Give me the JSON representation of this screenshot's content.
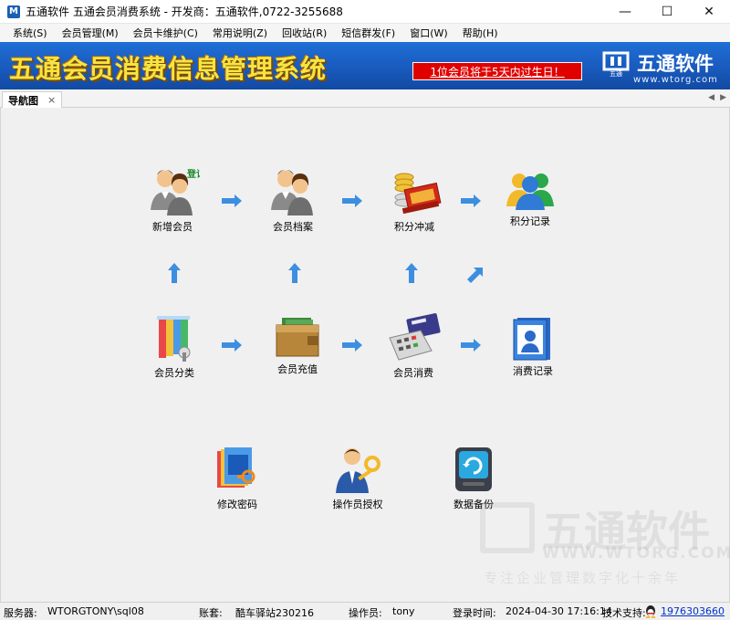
{
  "window": {
    "title": "五通软件  五通会员消费系统 - 开发商：五通软件,0722-3255688",
    "app_icon": "M",
    "min_glyph": "—",
    "max_glyph": "☐",
    "close_glyph": "✕"
  },
  "menu": [
    {
      "label": "系统(S)"
    },
    {
      "label": "会员管理(M)"
    },
    {
      "label": "会员卡维护(C)"
    },
    {
      "label": "常用说明(Z)"
    },
    {
      "label": "回收站(R)"
    },
    {
      "label": "短信群发(F)"
    },
    {
      "label": "窗口(W)"
    },
    {
      "label": "帮助(H)"
    }
  ],
  "banner": {
    "title": "五通会员消费信息管理系统",
    "alert": "1位会员将于5天内过生日！",
    "logo_name": "五通软件",
    "logo_mark_text": "五通",
    "logo_url": "www.wtorg.com"
  },
  "tab": {
    "label": "导航图",
    "close": "×"
  },
  "nav": {
    "register_badge": "登记",
    "items": [
      {
        "label": "新增会员",
        "icon": "add-member-icon"
      },
      {
        "label": "会员档案",
        "icon": "member-profile-icon"
      },
      {
        "label": "积分冲减",
        "icon": "points-deduct-icon"
      },
      {
        "label": "积分记录",
        "icon": "points-record-icon"
      },
      {
        "label": "会员分类",
        "icon": "member-category-icon"
      },
      {
        "label": "会员充值",
        "icon": "wallet-icon"
      },
      {
        "label": "会员消费",
        "icon": "pos-terminal-icon"
      },
      {
        "label": "消费记录",
        "icon": "consumption-record-icon"
      },
      {
        "label": "修改密码",
        "icon": "change-password-icon"
      },
      {
        "label": "操作员授权",
        "icon": "operator-auth-icon"
      },
      {
        "label": "数据备份",
        "icon": "data-backup-icon"
      }
    ]
  },
  "watermark": {
    "name": "五通软件",
    "url": "WWW.WTORG.COM",
    "slogan": "专注企业管理数字化十余年"
  },
  "status": {
    "server_label": "服务器:",
    "server_value": "WTORGTONY\\sql08",
    "account_label": "账套:",
    "account_value": "酷车驿站230216",
    "operator_label": "操作员:",
    "operator_value": "tony",
    "login_label": "登录时间:",
    "login_value": "2024-04-30 17:16:14",
    "support_label": "技术支持:",
    "support_value": "1976303660"
  },
  "colors": {
    "banner_blue": "#1a5cc0",
    "banner_title": "#f7e442",
    "alert_red": "#e00000",
    "link_blue": "#0033cc",
    "arrow_blue": "#3c8ee0"
  }
}
